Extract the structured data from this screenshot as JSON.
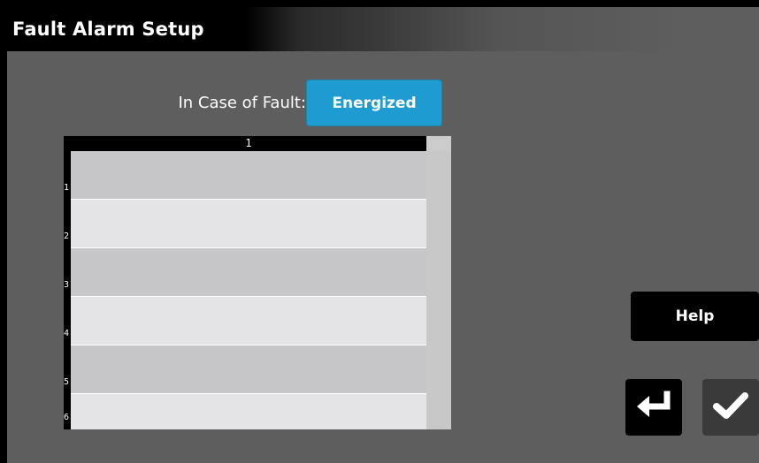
{
  "window": {
    "title": "Fault Alarm Setup"
  },
  "fault": {
    "label": "In Case of Fault:",
    "value": "Energized"
  },
  "table": {
    "column_headers": [
      "1"
    ],
    "rows": [
      {
        "header": "1",
        "value": ""
      },
      {
        "header": "2",
        "value": ""
      },
      {
        "header": "3",
        "value": ""
      },
      {
        "header": "4",
        "value": ""
      },
      {
        "header": "5",
        "value": ""
      },
      {
        "header": "6",
        "value": ""
      }
    ]
  },
  "buttons": {
    "help": "Help",
    "back_icon": "return-arrow-icon",
    "ok_icon": "checkmark-icon"
  },
  "colors": {
    "accent": "#1e9bd0",
    "background": "#5e5e5e",
    "titlebar": "#000000"
  }
}
